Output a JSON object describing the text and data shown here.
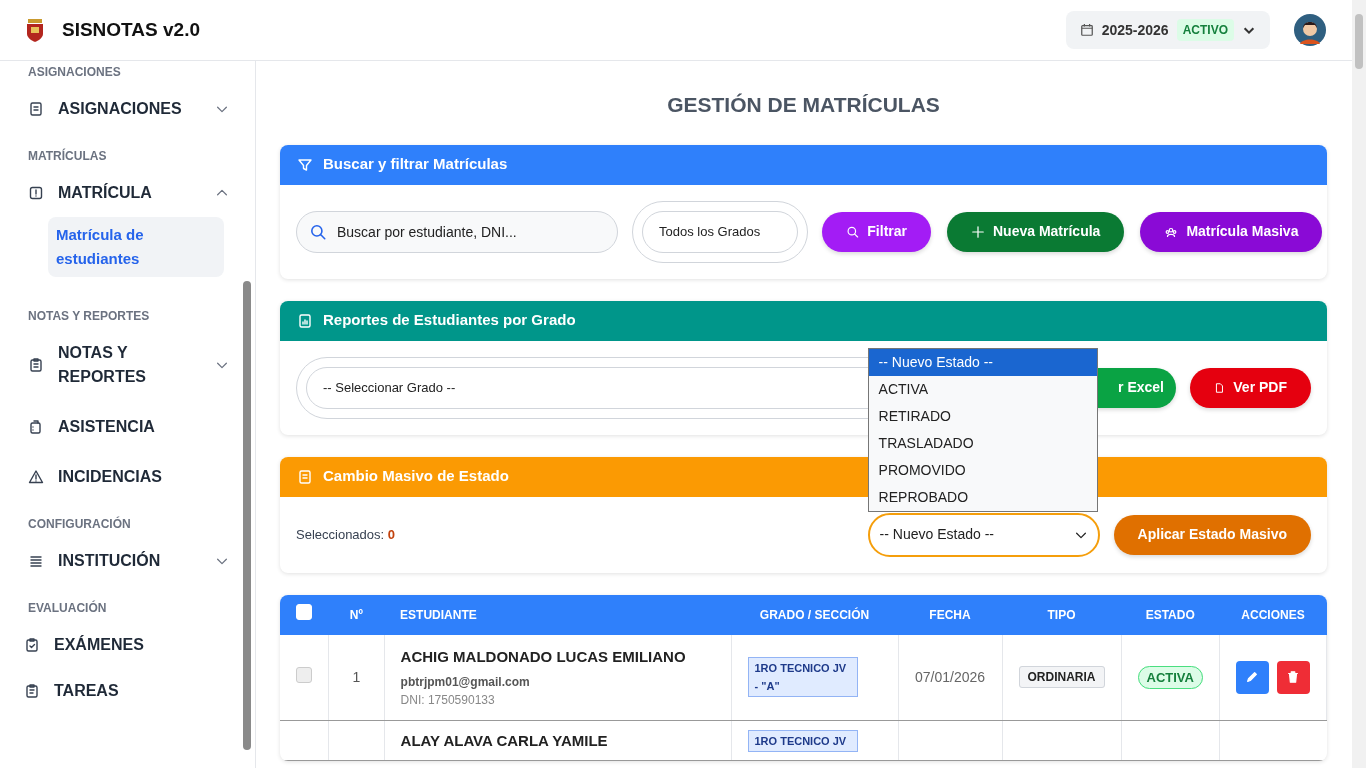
{
  "app": {
    "title": "SISNOTAS v2.0"
  },
  "year_selector": {
    "year": "2025-2026",
    "status": "ACTIVO"
  },
  "sidebar": {
    "sections": [
      {
        "label": "ASIGNACIONES",
        "items": [
          {
            "label": "ASIGNACIONES",
            "kind": "group",
            "expanded": false
          }
        ]
      },
      {
        "label": "MATRÍCULAS",
        "items": [
          {
            "label": "MATRÍCULA",
            "kind": "group",
            "expanded": true,
            "children": [
              {
                "label": "Matrícula de estudiantes",
                "selected": true
              }
            ]
          }
        ]
      },
      {
        "label": "NOTAS Y REPORTES",
        "items": [
          {
            "label": "NOTAS Y REPORTES",
            "kind": "group",
            "expanded": false
          },
          {
            "label": "ASISTENCIA",
            "kind": "link"
          },
          {
            "label": "INCIDENCIAS",
            "kind": "link"
          }
        ]
      },
      {
        "label": "CONFIGURACIÓN",
        "items": [
          {
            "label": "INSTITUCIÓN",
            "kind": "group",
            "expanded": false
          }
        ]
      },
      {
        "label": "EVALUACIÓN",
        "items": [
          {
            "label": "EXÁMENES",
            "kind": "link"
          },
          {
            "label": "TAREAS",
            "kind": "link"
          }
        ]
      }
    ]
  },
  "page_title": "GESTIÓN DE MATRÍCULAS",
  "filter_card": {
    "title": "Buscar y filtrar Matrículas",
    "search": {
      "placeholder": "Buscar por estudiante, DNI..."
    },
    "grade_select": "Todos los Grados",
    "buttons": [
      "Filtrar",
      "Nueva Matrícula",
      "Matrícula Masiva"
    ]
  },
  "report_card": {
    "title": "Reportes de Estudiantes por Grado",
    "grade_select": "-- Seleccionar Grado --",
    "buttons": [
      "r Excel",
      "Ver PDF"
    ]
  },
  "bulk_card": {
    "title": "Cambio Masivo de Estado",
    "selected_label": "Seleccionados:",
    "selected_count": "0",
    "status_select": "-- Nuevo Estado --",
    "open": true,
    "options": [
      {
        "label": "-- Nuevo Estado --",
        "selected": true
      },
      {
        "label": "ACTIVA",
        "selected": false
      },
      {
        "label": "RETIRADO",
        "selected": false
      },
      {
        "label": "TRASLADADO",
        "selected": false
      },
      {
        "label": "PROMOVIDO",
        "selected": false
      },
      {
        "label": "REPROBADO",
        "selected": false
      }
    ],
    "apply_button": "Aplicar Estado Masivo"
  },
  "table": {
    "all_checked": false,
    "columns": [
      "Nº",
      "ESTUDIANTE",
      "GRADO / SECCIÓN",
      "FECHA",
      "TIPO",
      "ESTADO",
      "ACCIONES"
    ],
    "rows": [
      {
        "checked": false,
        "number": "1",
        "name": "ACHIG MALDONADO LUCAS EMILIANO",
        "email": "pbtrjpm01@gmail.com",
        "dni": "DNI: 1750590133",
        "grade": "1RO TECNICO JV - \"A\"",
        "date": "07/01/2026",
        "type": "ORDINARIA",
        "status": "ACTIVA"
      },
      {
        "name": "ALAY ALAVA CARLA YAMILE",
        "grade": "1RO TECNICO JV"
      }
    ]
  }
}
